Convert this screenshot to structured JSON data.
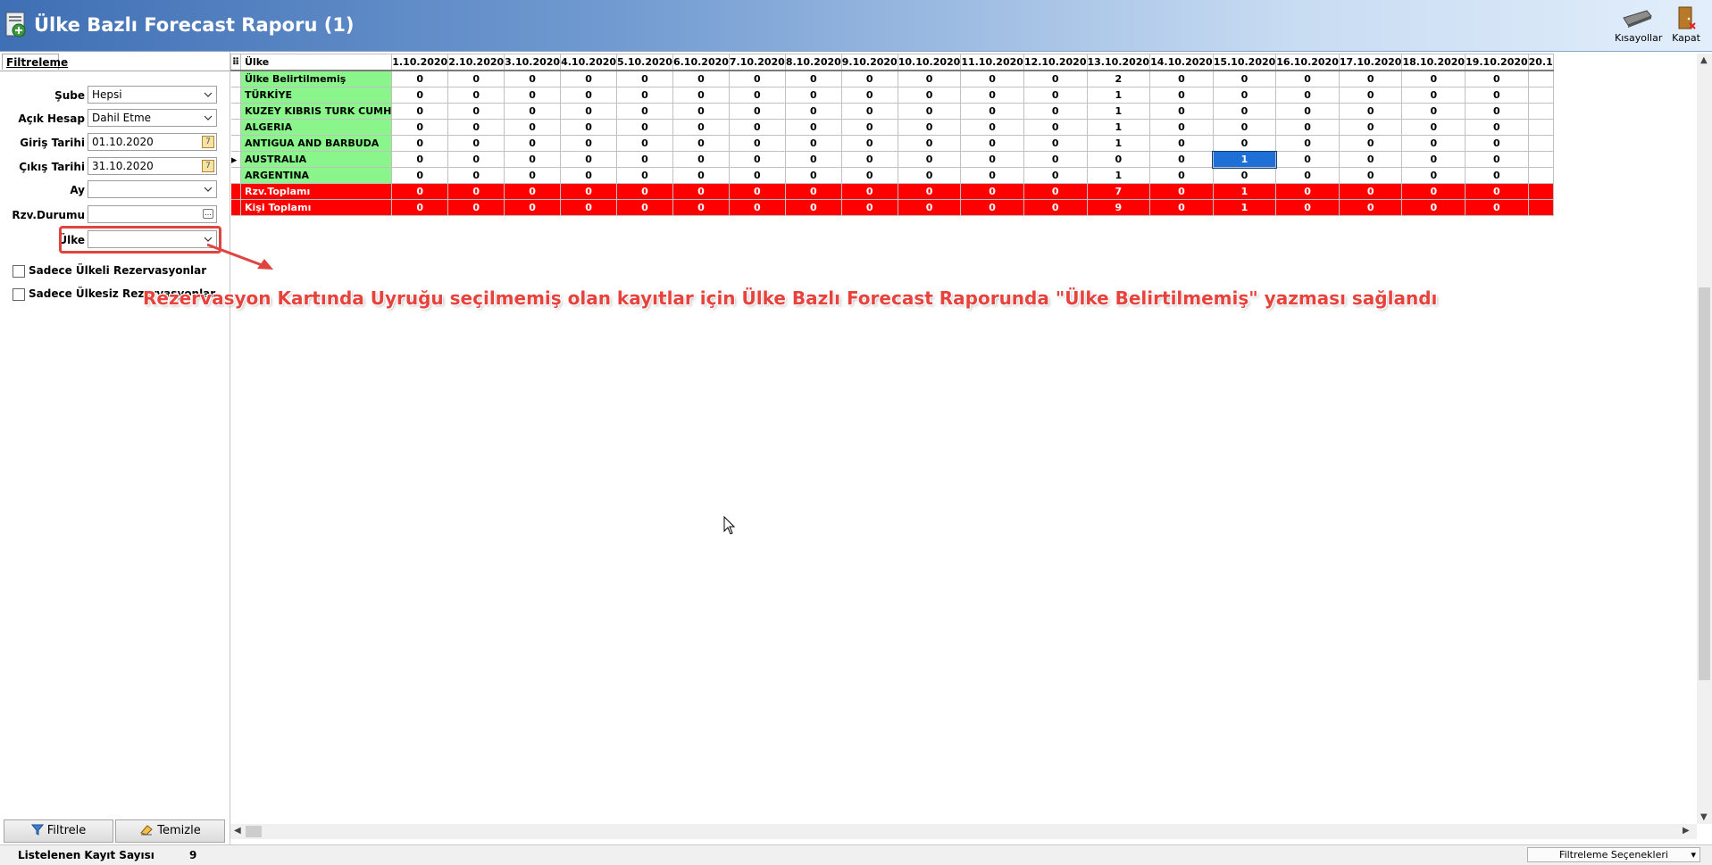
{
  "window": {
    "title": "Ülke Bazlı Forecast Raporu (1)"
  },
  "toolbar": {
    "shortcuts_label": "Kısayollar",
    "close_label": "Kapat"
  },
  "filter_panel": {
    "tab_label": "Filtreleme",
    "fields": {
      "sube": {
        "label": "Şube",
        "value": "Hepsi"
      },
      "acik_hesap": {
        "label": "Açık Hesap",
        "value": "Dahil Etme"
      },
      "giris_tarihi": {
        "label": "Giriş Tarihi",
        "value": "01.10.2020"
      },
      "cikis_tarihi": {
        "label": "Çıkış Tarihi",
        "value": "31.10.2020"
      },
      "ay": {
        "label": "Ay",
        "value": ""
      },
      "rzv_durumu": {
        "label": "Rzv.Durumu",
        "value": ""
      },
      "ulke": {
        "label": "Ülke",
        "value": ""
      }
    },
    "checkboxes": {
      "ulkeli": "Sadece Ülkeli Rezervasyonlar",
      "ulkesiz": "Sadece Ülkesiz Rezervasyonlar"
    },
    "buttons": {
      "filter": "Filtrele",
      "clear": "Temizle"
    }
  },
  "grid": {
    "first_col_header": "Ülke",
    "date_headers": [
      "1.10.2020",
      "2.10.2020",
      "3.10.2020",
      "4.10.2020",
      "5.10.2020",
      "6.10.2020",
      "7.10.2020",
      "8.10.2020",
      "9.10.2020",
      "10.10.2020",
      "11.10.2020",
      "12.10.2020",
      "13.10.2020",
      "14.10.2020",
      "15.10.2020",
      "16.10.2020",
      "17.10.2020",
      "18.10.2020",
      "19.10.2020",
      "20.1"
    ],
    "rows": [
      {
        "name": "Ülke Belirtilmemiş",
        "values": [
          "0",
          "0",
          "0",
          "0",
          "0",
          "0",
          "0",
          "0",
          "0",
          "0",
          "0",
          "0",
          "2",
          "0",
          "0",
          "0",
          "0",
          "0",
          "0",
          ""
        ],
        "type": "country"
      },
      {
        "name": "TÜRKİYE",
        "values": [
          "0",
          "0",
          "0",
          "0",
          "0",
          "0",
          "0",
          "0",
          "0",
          "0",
          "0",
          "0",
          "1",
          "0",
          "0",
          "0",
          "0",
          "0",
          "0",
          ""
        ],
        "type": "country"
      },
      {
        "name": "KUZEY KIBRIS TURK CUMH",
        "values": [
          "0",
          "0",
          "0",
          "0",
          "0",
          "0",
          "0",
          "0",
          "0",
          "0",
          "0",
          "0",
          "1",
          "0",
          "0",
          "0",
          "0",
          "0",
          "0",
          ""
        ],
        "type": "country"
      },
      {
        "name": "ALGERIA",
        "values": [
          "0",
          "0",
          "0",
          "0",
          "0",
          "0",
          "0",
          "0",
          "0",
          "0",
          "0",
          "0",
          "1",
          "0",
          "0",
          "0",
          "0",
          "0",
          "0",
          ""
        ],
        "type": "country"
      },
      {
        "name": "ANTIGUA AND BARBUDA",
        "values": [
          "0",
          "0",
          "0",
          "0",
          "0",
          "0",
          "0",
          "0",
          "0",
          "0",
          "0",
          "0",
          "1",
          "0",
          "0",
          "0",
          "0",
          "0",
          "0",
          ""
        ],
        "type": "country"
      },
      {
        "name": "AUSTRALIA",
        "values": [
          "0",
          "0",
          "0",
          "0",
          "0",
          "0",
          "0",
          "0",
          "0",
          "0",
          "0",
          "0",
          "0",
          "0",
          "1",
          "0",
          "0",
          "0",
          "0",
          ""
        ],
        "type": "country",
        "current": true
      },
      {
        "name": "ARGENTINA",
        "values": [
          "0",
          "0",
          "0",
          "0",
          "0",
          "0",
          "0",
          "0",
          "0",
          "0",
          "0",
          "0",
          "1",
          "0",
          "0",
          "0",
          "0",
          "0",
          "0",
          ""
        ],
        "type": "country"
      },
      {
        "name": "Rzv.Toplamı",
        "values": [
          "0",
          "0",
          "0",
          "0",
          "0",
          "0",
          "0",
          "0",
          "0",
          "0",
          "0",
          "0",
          "7",
          "0",
          "1",
          "0",
          "0",
          "0",
          "0",
          ""
        ],
        "type": "total"
      },
      {
        "name": "Kişi Toplamı",
        "values": [
          "0",
          "0",
          "0",
          "0",
          "0",
          "0",
          "0",
          "0",
          "0",
          "0",
          "0",
          "0",
          "9",
          "0",
          "1",
          "0",
          "0",
          "0",
          "0",
          ""
        ],
        "type": "total"
      }
    ],
    "selected_cell": {
      "row": 5,
      "col": 14
    }
  },
  "annotation": "Rezervasyon Kartında Uyruğu seçilmemiş olan kayıtlar için  Ülke Bazlı Forecast Raporunda \"Ülke Belirtilmemiş\" yazması sağlandı",
  "status_bar": {
    "records_label": "Listelenen Kayıt Sayısı",
    "records_count": "9",
    "filter_options": "Filtreleme Seçenekleri"
  },
  "colors": {
    "country_cell": "#8af58a",
    "total_row": "#ff0000",
    "selected_cell": "#1e6fd6",
    "annotation": "#e8423d"
  }
}
